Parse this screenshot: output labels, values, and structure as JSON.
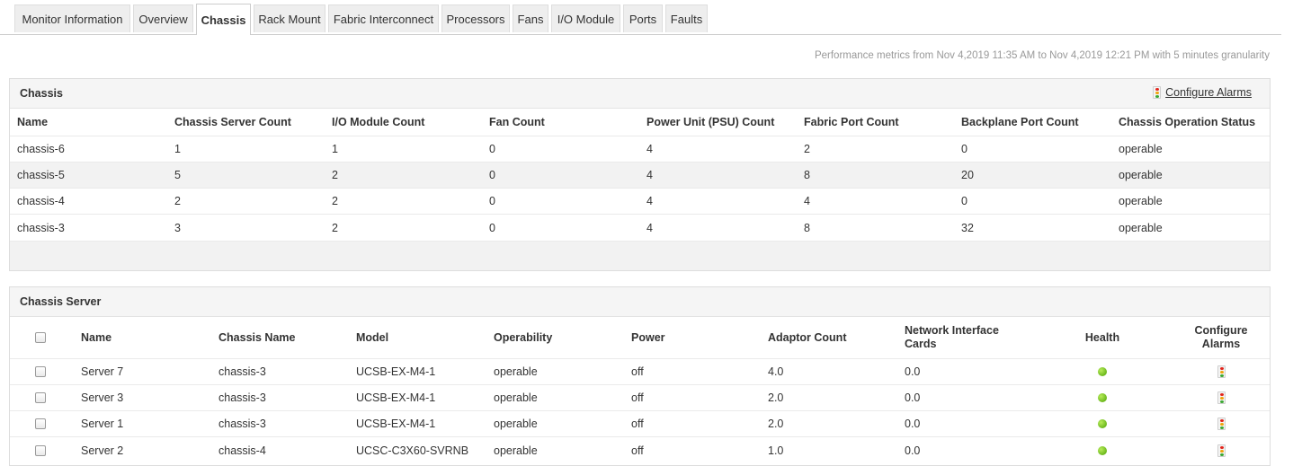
{
  "tabs": [
    {
      "label": "Monitor Information"
    },
    {
      "label": "Overview"
    },
    {
      "label": "Chassis",
      "active": true
    },
    {
      "label": "Rack Mount"
    },
    {
      "label": "Fabric Interconnect"
    },
    {
      "label": "Processors"
    },
    {
      "label": "Fans"
    },
    {
      "label": "I/O Module"
    },
    {
      "label": "Ports"
    },
    {
      "label": "Faults"
    }
  ],
  "perf_text": "Performance metrics from Nov 4,2019 11:35 AM to Nov 4,2019 12:21 PM with 5 minutes granularity",
  "chassis_panel": {
    "title": "Chassis",
    "configure_label": "Configure Alarms",
    "columns": [
      "Name",
      "Chassis Server Count",
      "I/O Module Count",
      "Fan Count",
      "Power Unit (PSU) Count",
      "Fabric Port Count",
      "Backplane Port Count",
      "Chassis Operation Status"
    ],
    "rows": [
      [
        "chassis-6",
        "1",
        "1",
        "0",
        "4",
        "2",
        "0",
        "operable"
      ],
      [
        "chassis-5",
        "5",
        "2",
        "0",
        "4",
        "8",
        "20",
        "operable"
      ],
      [
        "chassis-4",
        "2",
        "2",
        "0",
        "4",
        "4",
        "0",
        "operable"
      ],
      [
        "chassis-3",
        "3",
        "2",
        "0",
        "4",
        "8",
        "32",
        "operable"
      ]
    ]
  },
  "server_panel": {
    "title": "Chassis Server",
    "columns": [
      "Name",
      "Chassis Name",
      "Model",
      "Operability",
      "Power",
      "Adaptor Count",
      "Network Interface Cards",
      "Health",
      "Configure Alarms"
    ],
    "rows": [
      [
        "Server 7",
        "chassis-3",
        "UCSB-EX-M4-1",
        "operable",
        "off",
        "4.0",
        "0.0"
      ],
      [
        "Server 3",
        "chassis-3",
        "UCSB-EX-M4-1",
        "operable",
        "off",
        "2.0",
        "0.0"
      ],
      [
        "Server 1",
        "chassis-3",
        "UCSB-EX-M4-1",
        "operable",
        "off",
        "2.0",
        "0.0"
      ],
      [
        "Server 2",
        "chassis-4",
        "UCSC-C3X60-SVRNB",
        "operable",
        "off",
        "1.0",
        "0.0"
      ]
    ],
    "health_icon": "green-status-icon",
    "alarm_icon": "traffic-light-icon",
    "health_color": "#6cb81d"
  }
}
